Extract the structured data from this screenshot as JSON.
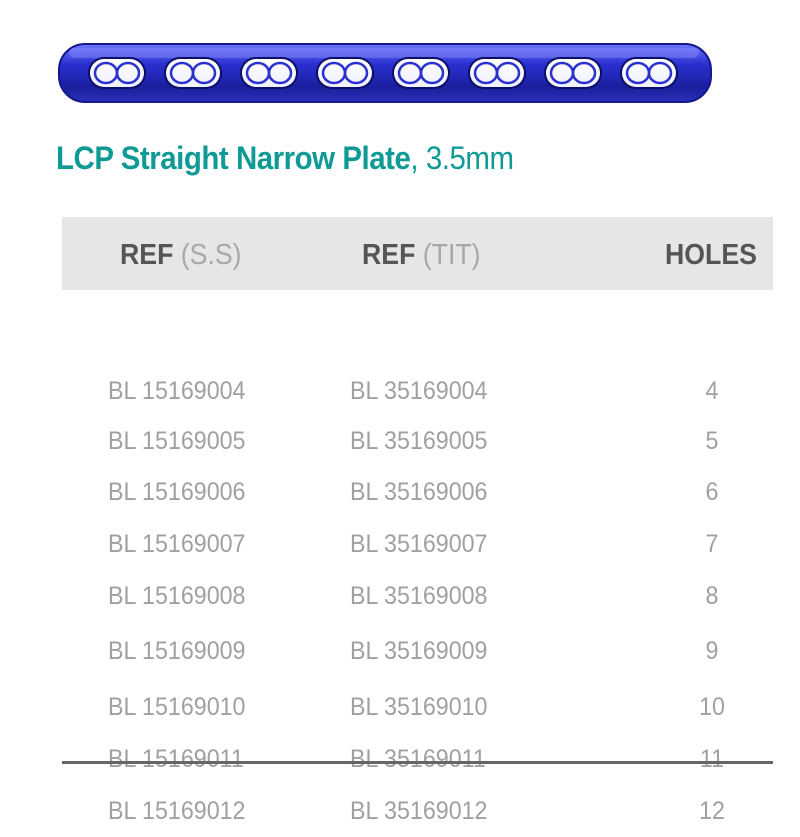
{
  "title": {
    "bold": "LCP Straight Narrow Plate",
    "rest": ", 3.5mm"
  },
  "colors": {
    "title": "#0f9a95",
    "plate": "#2a2fd0",
    "header_bg": "#e6e6e6",
    "cell_text": "#a0a0a0"
  },
  "plate": {
    "image": "blue-bone-plate-illustration",
    "holes": 8
  },
  "table": {
    "headers": [
      {
        "strong": "REF",
        "light": "(S.S)"
      },
      {
        "strong": "REF",
        "light": "(TIT)"
      },
      {
        "strong": "HOLES",
        "light": ""
      }
    ],
    "rows": [
      [
        "BL 15169004",
        "BL 35169004",
        "4"
      ],
      [
        "BL 15169005",
        "BL 35169005",
        "5"
      ],
      [
        "BL 15169006",
        "BL 35169006",
        "6"
      ],
      [
        "BL 15169007",
        "BL 35169007",
        "7"
      ],
      [
        "BL 15169008",
        "BL 35169008",
        "8"
      ],
      [
        "BL 15169009",
        "BL 35169009",
        "9"
      ],
      [
        "BL 15169010",
        "BL 35169010",
        "10"
      ],
      [
        "BL 15169011",
        "BL 35169011",
        "11"
      ],
      [
        "BL 15169012",
        "BL 35169012",
        "12"
      ]
    ]
  }
}
